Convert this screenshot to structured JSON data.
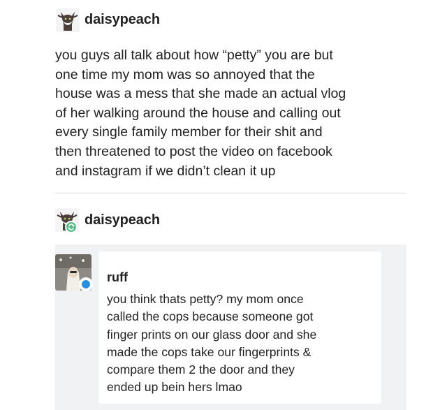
{
  "post": {
    "avatar_icon": "cat-avatar-icon",
    "username": "daisypeach",
    "body_lines": [
      "you guys all talk about how “petty” you are but",
      "one time my mom was so annoyed that the",
      "house was a mess that she made an actual vlog",
      "of her walking around the house and calling out",
      "every single family member for their shit and",
      "then threatened to post the video on facebook",
      "and instagram if we didn’t clean it up"
    ]
  },
  "reblog": {
    "avatar_icon": "cat-avatar-icon",
    "badge_icon": "reblog-icon",
    "username": "daisypeach"
  },
  "quote": {
    "avatar_icon": "person-avatar-icon",
    "status_icon": "online-dot-icon",
    "username": "ruff",
    "body_lines": [
      "you think thats petty? my mom once",
      "called the cops because someone got",
      "finger prints on our glass door and she",
      "made the cops take our fingerprints &",
      "compare them 2 the door and they",
      "ended up bein hers lmao"
    ]
  },
  "colors": {
    "text": "#222222",
    "divider": "#dcdcdc",
    "quote_background": "#f1f2f4",
    "reblog_badge": "#56bc8a",
    "status_dot": "#2a8ed8"
  }
}
